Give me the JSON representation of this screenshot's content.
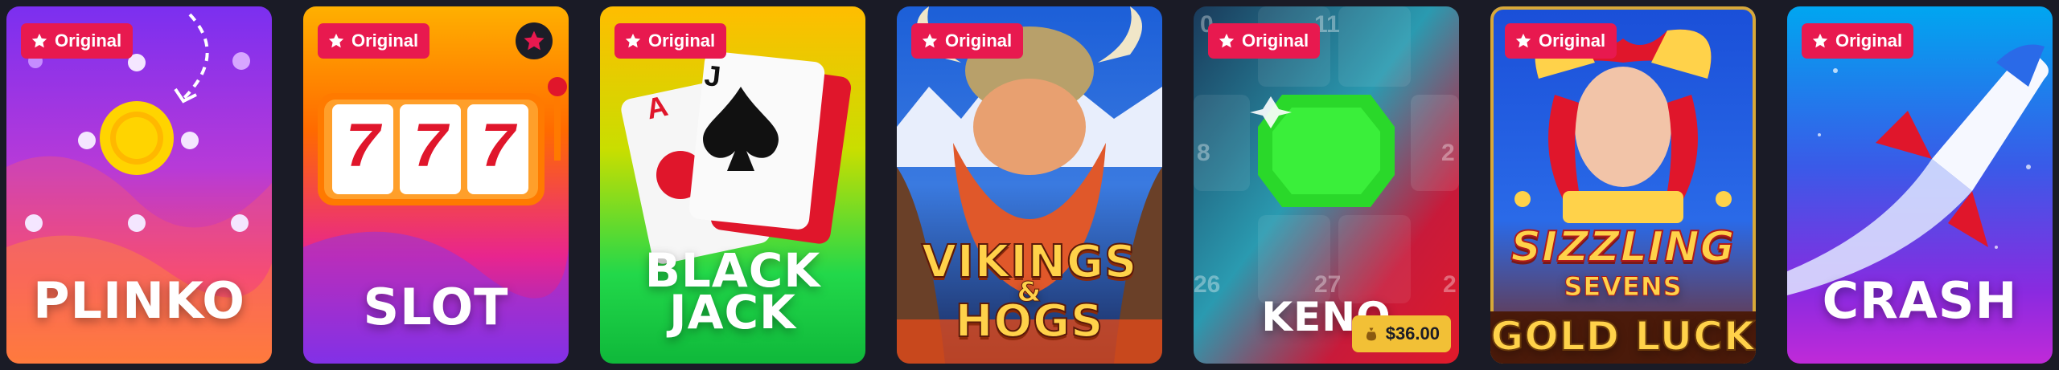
{
  "games": [
    {
      "badge": "Original",
      "title": "PLINKO"
    },
    {
      "badge": "Original",
      "title": "SLOT",
      "reels": [
        "7",
        "7",
        "7"
      ]
    },
    {
      "badge": "Original",
      "title_line1": "BLACK",
      "title_line2": "JACK",
      "cards": [
        "A",
        "J"
      ]
    },
    {
      "badge": "Original",
      "title_line1": "VIKINGS",
      "title_amp": "&",
      "title_line2": "HOGS"
    },
    {
      "badge": "Original",
      "title": "KENO",
      "prize": "$36.00",
      "grid_numbers": [
        "0",
        "11",
        "8",
        "2",
        "26",
        "27",
        "2"
      ]
    },
    {
      "badge": "Original",
      "title_line1": "SIZZLING",
      "title_line2": "SEVENS",
      "title_line3": "GOLD LUCK"
    },
    {
      "badge": "Original",
      "title": "CRASH"
    }
  ],
  "colors": {
    "background": "#1a1b26",
    "badge": "#e8194f",
    "prize": "#f2c036"
  }
}
